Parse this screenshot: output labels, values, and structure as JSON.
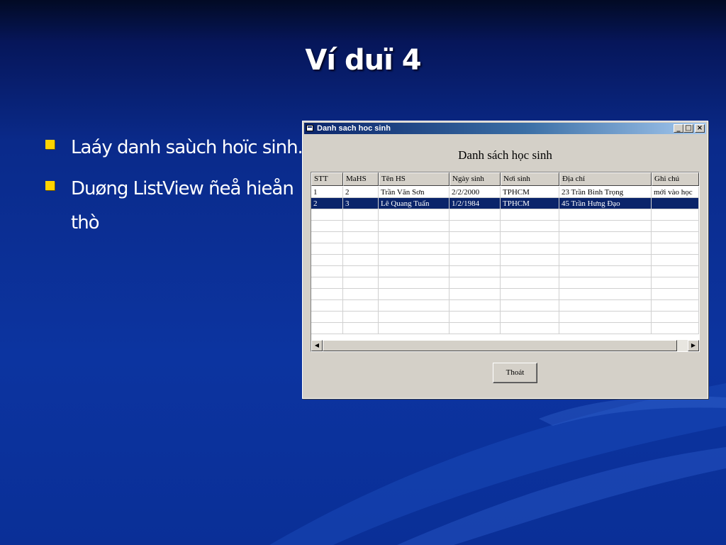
{
  "slide": {
    "title": "Ví duï 4",
    "bullets": [
      {
        "text": "Laáy danh saùch hoïc sinh."
      },
      {
        "text": "Duøng ListView ñeå hieån thò"
      }
    ]
  },
  "window": {
    "title": "Danh sach hoc sinh",
    "controls": [
      "_",
      "□",
      "×"
    ],
    "heading": "Danh sách học sinh",
    "list": {
      "columns": [
        "STT",
        "MaHS",
        "Tên HS",
        "Ngày sinh",
        "Nơi sinh",
        "Địa chỉ",
        "Ghi chú"
      ],
      "rows": [
        [
          "1",
          "2",
          "Trần Văn Sơn",
          "2/2/2000",
          "TPHCM",
          "23 Trần Bình Trọng",
          "mới vào học"
        ],
        [
          "2",
          "3",
          "Lê Quang Tuấn",
          "1/2/1984",
          "TPHCM",
          "45 Trần Hưng Đạo",
          ""
        ]
      ],
      "selected_row": 1
    },
    "exit_button": "Thoát"
  },
  "colors": {
    "background": "#0c34a0",
    "bullet": "#ffd400",
    "selection": "#0a246a",
    "titlebar_start": "#0a246a",
    "titlebar_end": "#a6caf0"
  }
}
